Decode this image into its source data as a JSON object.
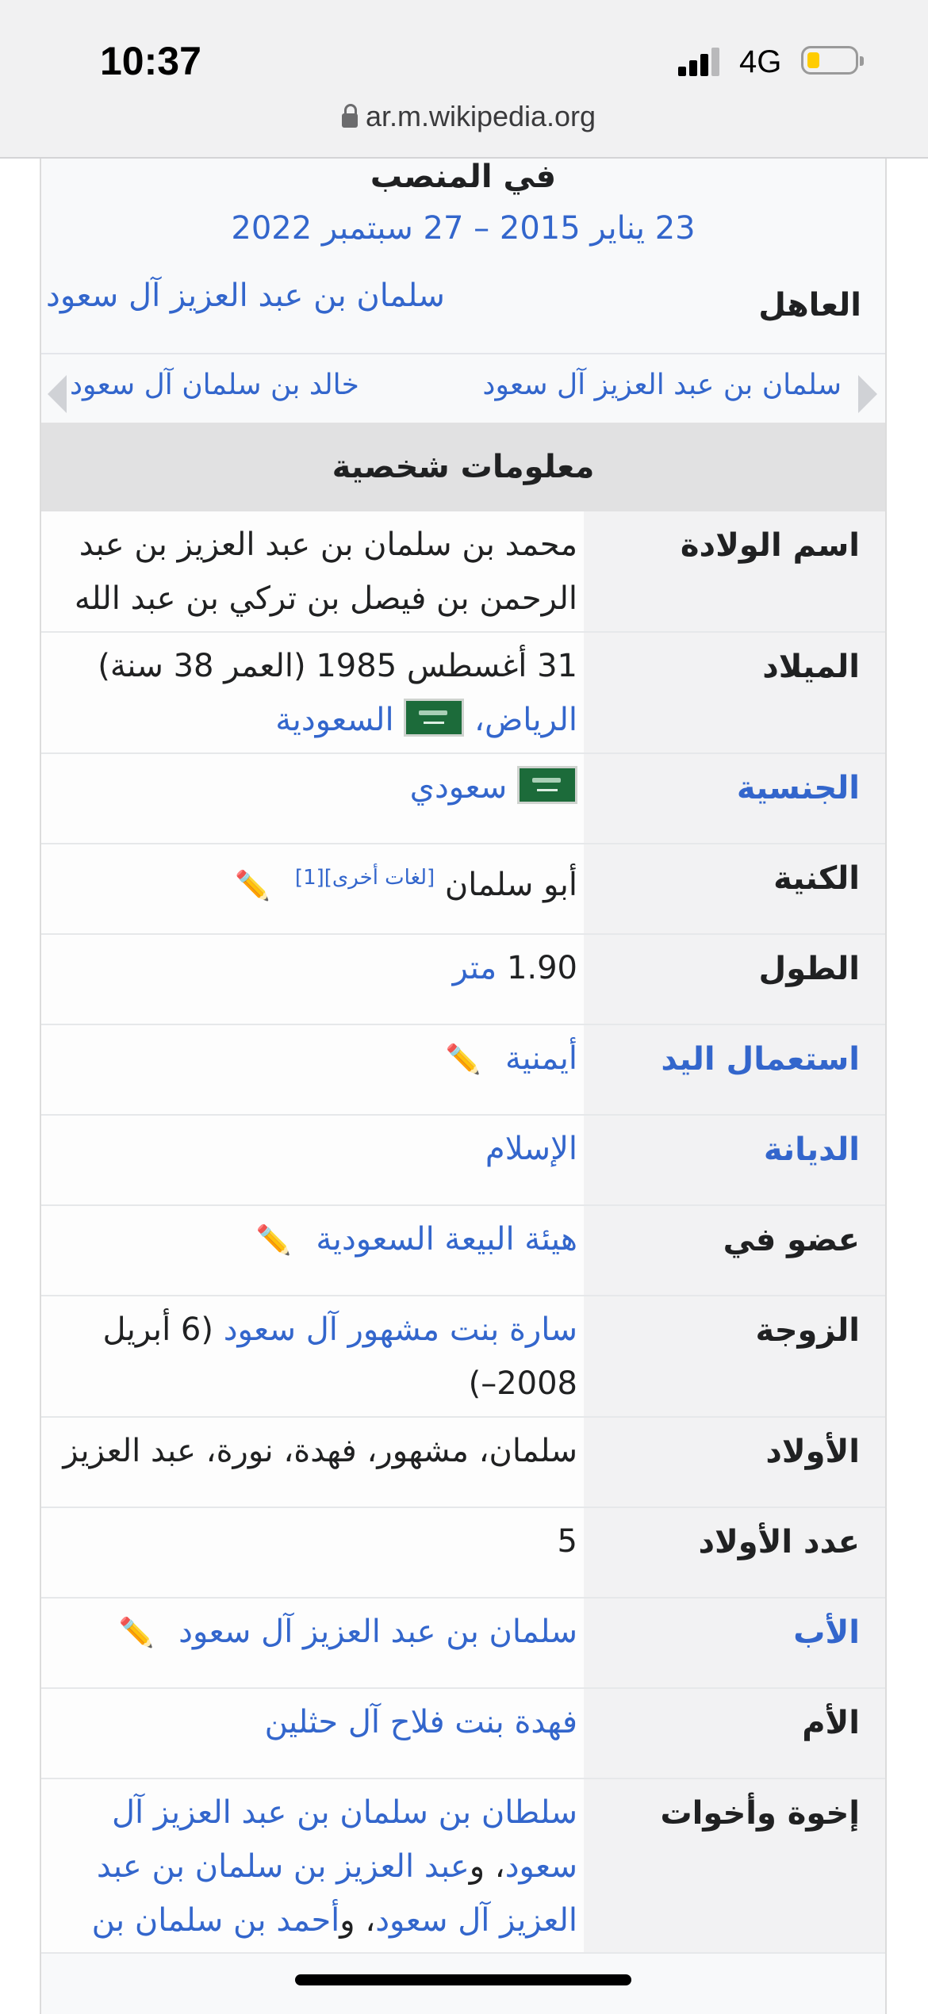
{
  "status_bar": {
    "time": "10:37",
    "network": "4G",
    "battery_level": 0.25,
    "url": "ar.m.wikipedia.org"
  },
  "office": {
    "heading": "في المنصب",
    "dates": "23 يناير 2015 – 27 سبتمبر 2022",
    "monarch_label": "العاهل",
    "monarch_value": "سلمان بن عبد العزيز آل سعود",
    "preceded_by": "سلمان بن عبد العزيز آل سعود",
    "succeeded_by": "خالد بن سلمان آل سعود"
  },
  "section_header": "معلومات شخصية",
  "rows": {
    "birth_name": {
      "label": "اسم الولادة",
      "value": "محمد بن سلمان بن عبد العزيز بن عبد الرحمن بن فيصل بن تركي بن عبد الله بن محمد بن سعود"
    },
    "birth": {
      "label": "الميلاد",
      "date": "31 أغسطس 1985 (العمر 38 سنة)",
      "city": "الرياض،",
      "country": "السعودية"
    },
    "nationality": {
      "label": "الجنسية",
      "value": "سعودي"
    },
    "kunya": {
      "label": "الكنية",
      "value": "أبو سلمان",
      "other_langs": "[لغات أخرى]",
      "ref": "[1]"
    },
    "height": {
      "label": "الطول",
      "number": "1.90",
      "unit": "متر"
    },
    "handedness": {
      "label": "استعمال اليد",
      "value": "أيمنية"
    },
    "religion": {
      "label": "الديانة",
      "value": "الإسلام"
    },
    "member_of": {
      "label": "عضو في",
      "value": "هيئة البيعة السعودية"
    },
    "spouse": {
      "label": "الزوجة",
      "name": "سارة بنت مشهور آل سعود",
      "dates": "(6 أبريل 2008–)"
    },
    "children": {
      "label": "الأولاد",
      "value": "سلمان، مشهور، فهدة، نورة، عبد العزيز"
    },
    "children_count": {
      "label": "عدد الأولاد",
      "value": "5"
    },
    "father": {
      "label": "الأب",
      "value": "سلمان بن عبد العزيز آل سعود"
    },
    "mother": {
      "label": "الأم",
      "value": "فهدة بنت فلاح آل حثلين"
    },
    "siblings": {
      "label": "إخوة وأخوات",
      "sib1": "سلطان بن سلمان بن عبد العزيز آل سعود",
      "sep1": "،   و",
      "sib2": "عبد العزيز بن سلمان بن عبد العزيز آل سعود",
      "sep2": "،   و",
      "sib3": "أحمد بن سلمان بن"
    }
  },
  "colors": {
    "link": "#3366cc",
    "label_bg": "#f2f2f3",
    "header_bg": "#e1e1e2",
    "battery": "#ffcc00"
  },
  "icons": [
    "lock-icon",
    "signal-icon",
    "battery-icon",
    "flag-icon",
    "pencil-icon",
    "arrow-right-icon",
    "arrow-left-icon"
  ]
}
